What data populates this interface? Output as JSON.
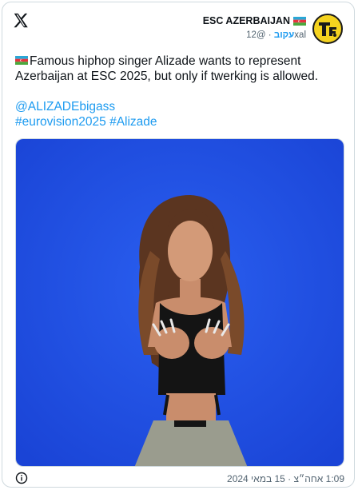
{
  "account": {
    "display_name": "ESC AZERBAIJAN",
    "handle": "@12xal",
    "follow_label": "עקוב",
    "separator": "·",
    "avatar_text": "T."
  },
  "tweet": {
    "line1": "Famous hiphop singer Alizade wants to represent",
    "line2": "Azerbaijan at ESC 2025, but only if twerking is allowed.",
    "mention": "@ALIZADEbigass",
    "hashtag1": "#eurovision2025",
    "hashtag2": "#Alizade"
  },
  "footer": {
    "timestamp": "1:09 אחה״צ · 15 במאי 2024"
  },
  "colors": {
    "accent": "#1d9bf0",
    "photo_background": "#1f4fe0",
    "avatar_yellow": "#f5d31f"
  },
  "icons": [
    "x-logo-icon",
    "azerbaijan-flag-icon",
    "info-icon"
  ]
}
